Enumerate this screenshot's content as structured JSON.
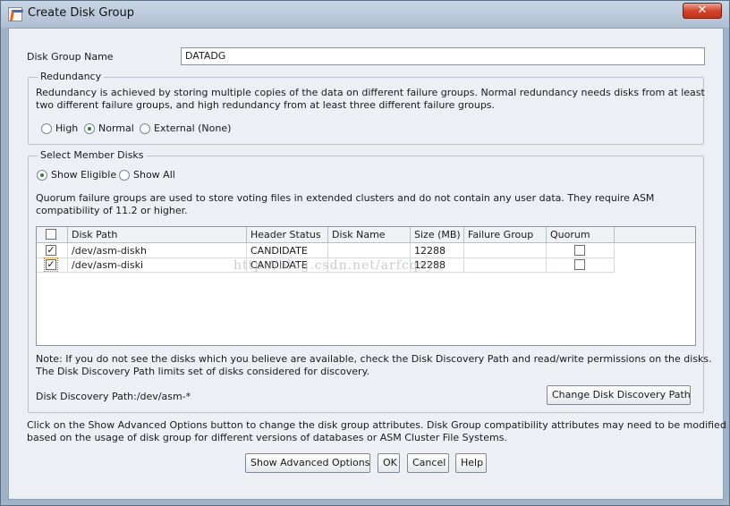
{
  "window": {
    "title": "Create Disk Group",
    "close_glyph": "✕"
  },
  "disk_group_name": {
    "label": "Disk Group Name",
    "value": "DATADG"
  },
  "redundancy": {
    "legend": "Redundancy",
    "description_line1": "Redundancy is achieved by storing multiple copies of the data on different failure groups. Normal redundancy needs disks from at least",
    "description_line2": "two different failure groups, and high redundancy from at least three different failure groups.",
    "options": [
      {
        "label": "High",
        "selected": false
      },
      {
        "label": "Normal",
        "selected": true
      },
      {
        "label": "External (None)",
        "selected": false
      }
    ]
  },
  "member_disks": {
    "legend": "Select Member Disks",
    "show_options": [
      {
        "label": "Show Eligible",
        "selected": true
      },
      {
        "label": "Show All",
        "selected": false
      }
    ],
    "quorum_note_line1": "Quorum failure groups are used to store voting files in extended clusters and do not contain any user data. They require ASM",
    "quorum_note_line2": "compatibility of 11.2 or higher.",
    "table": {
      "columns": [
        "",
        "Disk Path",
        "Header Status",
        "Disk Name",
        "Size (MB)",
        "Failure Group",
        "Quorum"
      ],
      "rows": [
        {
          "checked": true,
          "path": "/dev/asm-diskh",
          "status": "CANDIDATE",
          "name": "",
          "size": "12288",
          "failure_group": "",
          "quorum": false
        },
        {
          "checked": true,
          "path": "/dev/asm-diski",
          "status": "CANDIDATE",
          "name": "",
          "size": "12288",
          "failure_group": "",
          "quorum": false
        }
      ]
    },
    "discovery_note_line1": "Note: If you do not see the disks which you believe are available, check the Disk Discovery Path and read/write permissions on the disks.",
    "discovery_note_line2": "The Disk Discovery Path limits set of disks considered for discovery.",
    "discovery_path_label": "Disk Discovery Path:",
    "discovery_path_value": "/dev/asm-*",
    "change_path_button": "Change Disk Discovery Path"
  },
  "advanced_note_line1": "Click on the Show Advanced Options button to change the disk group attributes. Disk Group compatibility attributes may need to be modified",
  "advanced_note_line2": "based on the usage of disk group for different versions of databases or ASM Cluster File Systems.",
  "buttons": {
    "advanced": "Show Advanced Options",
    "ok": "OK",
    "cancel": "Cancel",
    "help": "Help"
  },
  "watermark": "http://blog.csdn.net/arfcqxyz"
}
